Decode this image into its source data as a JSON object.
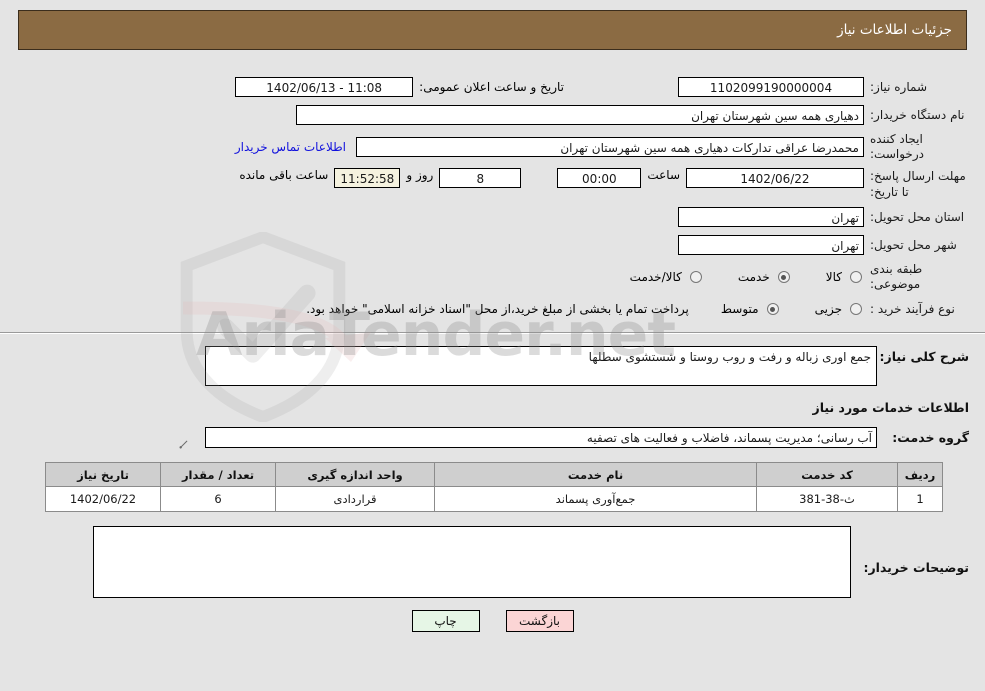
{
  "header": {
    "title": "جزئیات اطلاعات نیاز"
  },
  "form": {
    "need_number_label": "شماره نیاز:",
    "need_number_value": "1102099190000004",
    "announce_datetime_label": "تاریخ و ساعت اعلان عمومی:",
    "announce_datetime_value": "11:08 - 1402/06/13",
    "buyer_org_label": "نام دستگاه خریدار:",
    "buyer_org_value": "دهیاری همه سین شهرستان تهران",
    "creator_label": "ایجاد کننده درخواست:",
    "creator_value": "محمدرضا عراقی تدارکات دهیاری همه سین شهرستان تهران",
    "buyer_contact_link": "اطلاعات تماس خریدار",
    "deadline_label": "مهلت ارسال پاسخ: تا تاریخ:",
    "deadline_date": "1402/06/22",
    "deadline_hour_label": "ساعت",
    "deadline_hour_value": "00:00",
    "remaining_days": "8",
    "remaining_days_label": "روز و",
    "remaining_time": "11:52:58",
    "remaining_suffix": "ساعت باقی مانده",
    "province_label": "استان محل تحویل:",
    "province_value": "تهران",
    "city_label": "شهر محل تحویل:",
    "city_value": "تهران",
    "category_label": "طبقه بندی موضوعی:",
    "category_options": [
      {
        "label": "کالا",
        "selected": false
      },
      {
        "label": "خدمت",
        "selected": true
      },
      {
        "label": "کالا/خدمت",
        "selected": false
      }
    ],
    "process_label": "نوع فرآیند خرید :",
    "process_options": [
      {
        "label": "جزیی",
        "selected": false
      },
      {
        "label": "متوسط",
        "selected": true
      }
    ],
    "treasury_note": "پرداخت تمام یا بخشی از مبلغ خرید،از محل \"اسناد خزانه اسلامی\" خواهد بود."
  },
  "need_description": {
    "label": "شرح کلی نیاز:",
    "value": "جمع اوری زباله و رفت و روب روستا و شستشوی سطلها"
  },
  "services_section": {
    "title": "اطلاعات خدمات مورد نیاز",
    "group_label": "گروه خدمت:",
    "group_value": "آب رسانی؛ مدیریت پسماند، فاضلاب و فعالیت های تصفیه",
    "columns": [
      "ردیف",
      "کد خدمت",
      "نام خدمت",
      "واحد اندازه گیری",
      "تعداد / مقدار",
      "تاریخ نیاز"
    ],
    "rows": [
      {
        "row_no": "1",
        "service_code": "ث-38-381",
        "service_name": "جمع‌آوری پسماند",
        "unit": "قراردادی",
        "quantity": "6",
        "need_date": "1402/06/22"
      }
    ]
  },
  "buyer_notes": {
    "label": "توضیحات خریدار:",
    "value": ""
  },
  "footer": {
    "print_label": "چاپ",
    "back_label": "بازگشت"
  },
  "watermark": {
    "text": "AriaTender.net"
  },
  "colors": {
    "header_bg": "#8b6b43",
    "page_bg": "#e4e4e4",
    "link": "#1111dd",
    "back_btn": "#fbd5d5",
    "print_btn": "#e6f6e6",
    "cream_field": "#f5f2df"
  }
}
